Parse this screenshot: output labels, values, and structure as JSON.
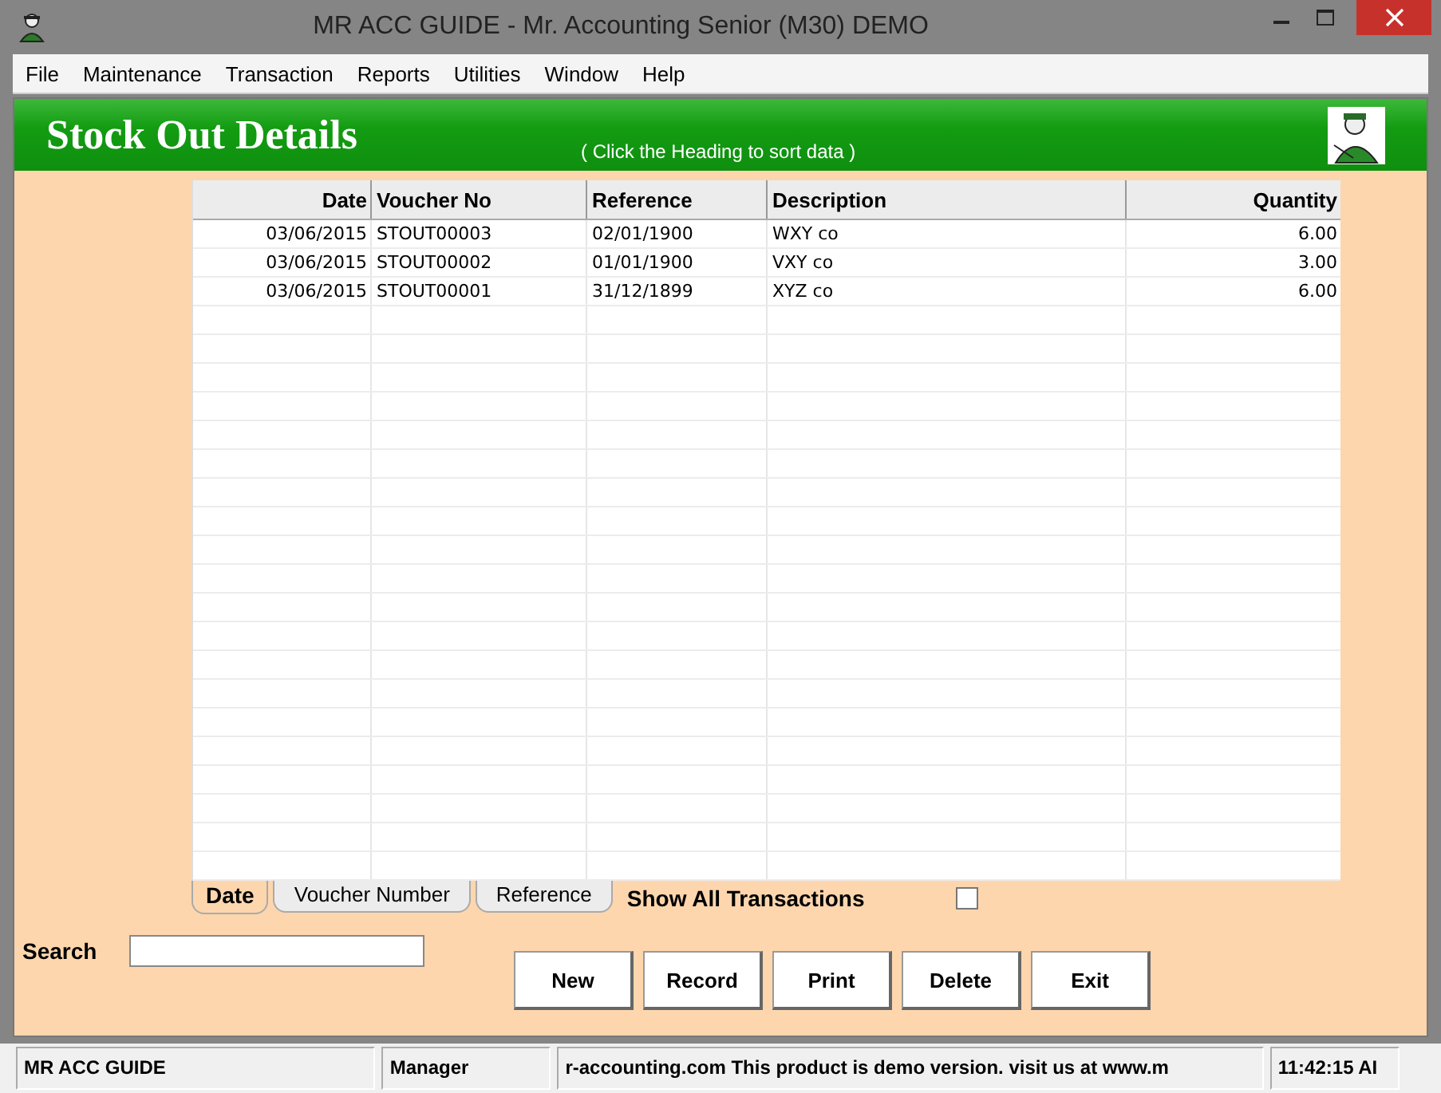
{
  "window": {
    "title": "MR ACC GUIDE - Mr. Accounting Senior (M30) DEMO"
  },
  "menu": [
    {
      "label": "File"
    },
    {
      "label": "Maintenance"
    },
    {
      "label": "Transaction"
    },
    {
      "label": "Reports"
    },
    {
      "label": "Utilities"
    },
    {
      "label": "Window"
    },
    {
      "label": "Help"
    }
  ],
  "header": {
    "title": "Stock Out Details",
    "hint": "( Click the Heading to sort data )"
  },
  "table": {
    "columns": [
      {
        "label": "Date",
        "kind": "date"
      },
      {
        "label": "Voucher No",
        "kind": "text"
      },
      {
        "label": "Reference",
        "kind": "text"
      },
      {
        "label": "Description",
        "kind": "text"
      },
      {
        "label": "Quantity",
        "kind": "number"
      }
    ],
    "rows": [
      [
        "03/06/2015",
        "STOUT00003",
        "02/01/1900",
        "WXY co",
        "6.00"
      ],
      [
        "03/06/2015",
        "STOUT00002",
        "01/01/1900",
        "VXY co",
        "3.00"
      ],
      [
        "03/06/2015",
        "STOUT00001",
        "31/12/1899",
        "XYZ co",
        "6.00"
      ]
    ]
  },
  "sort_tabs": [
    {
      "label": "Date",
      "selected": true
    },
    {
      "label": "Voucher Number",
      "selected": false
    },
    {
      "label": "Reference",
      "selected": false
    }
  ],
  "show_all": {
    "label": "Show All Transactions",
    "checked": false
  },
  "search": {
    "label": "Search"
  },
  "buttons": [
    {
      "label": "New"
    },
    {
      "label": "Record"
    },
    {
      "label": "Print"
    },
    {
      "label": "Delete"
    },
    {
      "label": "Exit"
    }
  ],
  "status_bar": [
    "MR ACC GUIDE",
    "Manager",
    "r-accounting.com This product is demo version.  visit us at www.m",
    "11:42:15 AI"
  ]
}
